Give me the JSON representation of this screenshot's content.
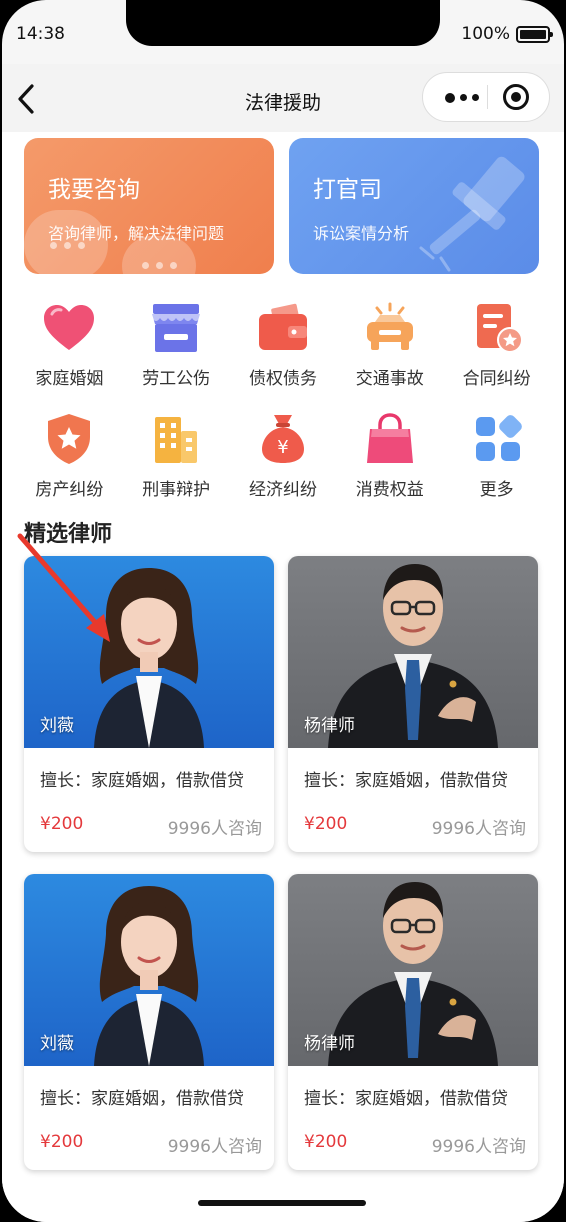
{
  "status": {
    "time": "14:38",
    "battery": "100%"
  },
  "nav": {
    "title": "法律援助"
  },
  "banners": [
    {
      "title": "我要咨询",
      "subtitle": "咨询律师，解决法律问题",
      "color": "#f07f4d"
    },
    {
      "title": "打官司",
      "subtitle": "诉讼案情分析",
      "color": "#5b8ce8"
    }
  ],
  "categories": [
    {
      "label": "家庭婚姻",
      "icon": "heart-icon"
    },
    {
      "label": "劳工公伤",
      "icon": "shop-icon"
    },
    {
      "label": "债权债务",
      "icon": "wallet-icon"
    },
    {
      "label": "交通事故",
      "icon": "car-icon"
    },
    {
      "label": "合同纠纷",
      "icon": "contract-icon"
    },
    {
      "label": "房产纠纷",
      "icon": "shield-star-icon"
    },
    {
      "label": "刑事辩护",
      "icon": "building-icon"
    },
    {
      "label": "经济纠纷",
      "icon": "money-bag-icon"
    },
    {
      "label": "消费权益",
      "icon": "shopping-bag-icon"
    },
    {
      "label": "更多",
      "icon": "grid-more-icon"
    }
  ],
  "section": {
    "title": "精选律师"
  },
  "lawyers": [
    {
      "name": "刘薇",
      "skill": "擅长：家庭婚姻，借款借贷",
      "price": "¥200",
      "count": "9996人咨询"
    },
    {
      "name": "杨律师",
      "skill": "擅长：家庭婚姻，借款借贷",
      "price": "¥200",
      "count": "9996人咨询"
    },
    {
      "name": "刘薇",
      "skill": "擅长：家庭婚姻，借款借贷",
      "price": "¥200",
      "count": "9996人咨询"
    },
    {
      "name": "杨律师",
      "skill": "擅长：家庭婚姻，借款借贷",
      "price": "¥200",
      "count": "9996人咨询"
    }
  ],
  "colors": {
    "accent_price": "#e4393c",
    "orange_banner": "#f07f4d",
    "blue_banner": "#5b8ce8"
  }
}
